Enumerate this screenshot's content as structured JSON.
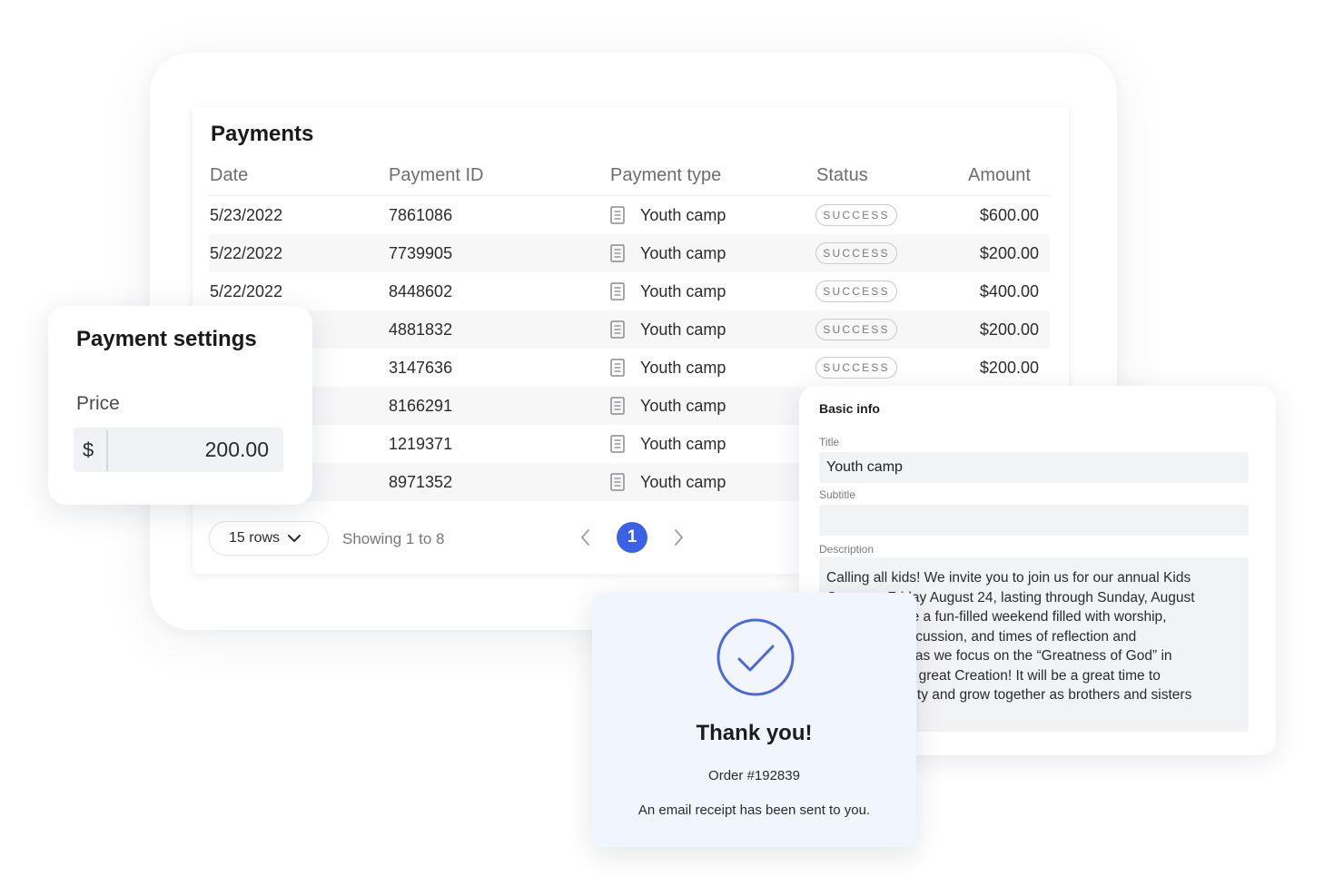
{
  "payments": {
    "title": "Payments",
    "columns": [
      "Date",
      "Payment ID",
      "Payment type",
      "Status",
      "Amount"
    ],
    "rows": [
      {
        "date": "5/23/2022",
        "id": "7861086",
        "type": "Youth camp",
        "status": "SUCCESS",
        "amount": "$600.00"
      },
      {
        "date": "5/22/2022",
        "id": "7739905",
        "type": "Youth camp",
        "status": "SUCCESS",
        "amount": "$200.00"
      },
      {
        "date": "5/22/2022",
        "id": "8448602",
        "type": "Youth camp",
        "status": "SUCCESS",
        "amount": "$400.00"
      },
      {
        "date": "",
        "id": "4881832",
        "type": "Youth camp",
        "status": "SUCCESS",
        "amount": "$200.00"
      },
      {
        "date": "",
        "id": "3147636",
        "type": "Youth camp",
        "status": "SUCCESS",
        "amount": "$200.00"
      },
      {
        "date": "",
        "id": "8166291",
        "type": "Youth camp",
        "status": "",
        "amount": ""
      },
      {
        "date": "",
        "id": "1219371",
        "type": "Youth camp",
        "status": "",
        "amount": ""
      },
      {
        "date": "",
        "id": "8971352",
        "type": "Youth camp",
        "status": "",
        "amount": ""
      }
    ],
    "pagination": {
      "rows_label": "15 rows",
      "showing": "Showing 1 to 8",
      "current_page": "1"
    },
    "type_icon": "document-icon"
  },
  "settings": {
    "title": "Payment settings",
    "price_label": "Price",
    "currency": "$",
    "price_value": "200.00"
  },
  "basic_info": {
    "title": "Basic info",
    "title_label": "Title",
    "title_value": "Youth camp",
    "subtitle_label": "Subtitle",
    "subtitle_value": "",
    "description_label": "Description",
    "description_lines": [
      "Calling all kids! We invite you to join us for our annual Kids",
      "Camp on Friday August 24, lasting through Sunday, August",
      "26. This will be a fun-filled weekend filled with worship,",
      "great food, discussion, and times of reflection and",
      "study. Join us as we focus on the “Greatness of God” in",
      "Christ and His great Creation! It will be a great time to",
      "build community and grow together as brothers and sisters"
    ]
  },
  "thank_you": {
    "title": "Thank you!",
    "order": "Order #192839",
    "note": "An email receipt has been sent to you."
  },
  "colors": {
    "accent": "#3b62e6",
    "check_ring": "#4f68d9",
    "thank_you_bg": "#f1f6fe",
    "row_alt": "#f7f7f8"
  }
}
